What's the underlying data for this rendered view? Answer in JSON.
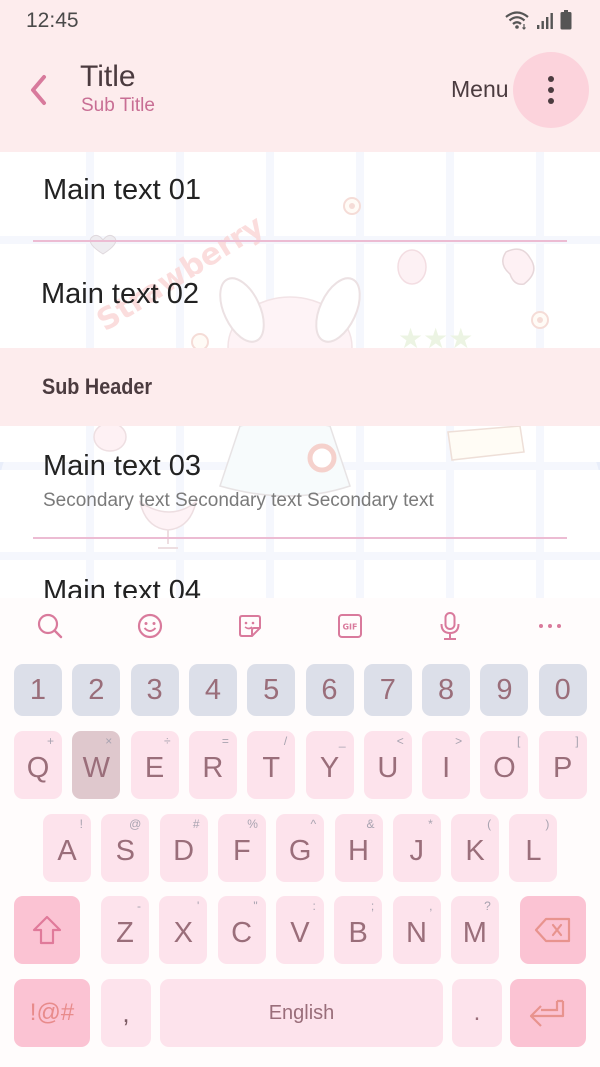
{
  "status_bar": {
    "time": "12:45",
    "icons": [
      "wifi-icon",
      "signal-icon",
      "battery-icon"
    ]
  },
  "app_bar": {
    "back_icon": "chevron-left-icon",
    "title": "Title",
    "subtitle": "Sub Title",
    "menu_label": "Menu",
    "more_icon": "more-vertical-icon"
  },
  "list": {
    "group1": [
      {
        "main": "Main text 01"
      },
      {
        "main": "Main text 02"
      }
    ],
    "subheader": "Sub Header",
    "group2": [
      {
        "main": "Main text 03",
        "secondary": "Secondary text Secondary text Secondary text"
      },
      {
        "main": "Main text 04"
      }
    ]
  },
  "keyboard": {
    "toolbar": [
      "search-icon",
      "emoji-icon",
      "sticker-icon",
      "gif-icon",
      "microphone-icon",
      "more-horizontal-icon"
    ],
    "gif_label": "GIF",
    "more_label": "•••",
    "number_row": [
      "1",
      "2",
      "3",
      "4",
      "5",
      "6",
      "7",
      "8",
      "9",
      "0"
    ],
    "row1": [
      {
        "key": "Q",
        "hint": "+"
      },
      {
        "key": "W",
        "hint": "×"
      },
      {
        "key": "E",
        "hint": "÷"
      },
      {
        "key": "R",
        "hint": "="
      },
      {
        "key": "T",
        "hint": "/"
      },
      {
        "key": "Y",
        "hint": "_"
      },
      {
        "key": "U",
        "hint": "<"
      },
      {
        "key": "I",
        "hint": ">"
      },
      {
        "key": "O",
        "hint": "["
      },
      {
        "key": "P",
        "hint": "]"
      }
    ],
    "row2": [
      {
        "key": "A",
        "hint": "!"
      },
      {
        "key": "S",
        "hint": "@"
      },
      {
        "key": "D",
        "hint": "#"
      },
      {
        "key": "F",
        "hint": "%"
      },
      {
        "key": "G",
        "hint": "^"
      },
      {
        "key": "H",
        "hint": "&"
      },
      {
        "key": "J",
        "hint": "*"
      },
      {
        "key": "K",
        "hint": "("
      },
      {
        "key": "L",
        "hint": ")"
      }
    ],
    "row3": [
      {
        "key": "Z",
        "hint": "-"
      },
      {
        "key": "X",
        "hint": "'"
      },
      {
        "key": "C",
        "hint": "\""
      },
      {
        "key": "V",
        "hint": ":"
      },
      {
        "key": "B",
        "hint": ";"
      },
      {
        "key": "N",
        "hint": ","
      },
      {
        "key": "M",
        "hint": "?"
      }
    ],
    "pressed_key": "W",
    "shift_icon": "shift-arrow-icon",
    "backspace_icon": "backspace-icon",
    "symbols_label": "!@#",
    "comma_label": ",",
    "space_label": "English",
    "period_label": ".",
    "enter_icon": "enter-icon"
  },
  "colors": {
    "background": "#fdeced",
    "accent": "#c86e94",
    "key": "#fde3ec",
    "number_key": "#dcdfe9",
    "function_key": "#fbc3d3",
    "key_text": "#9a6e7a"
  }
}
